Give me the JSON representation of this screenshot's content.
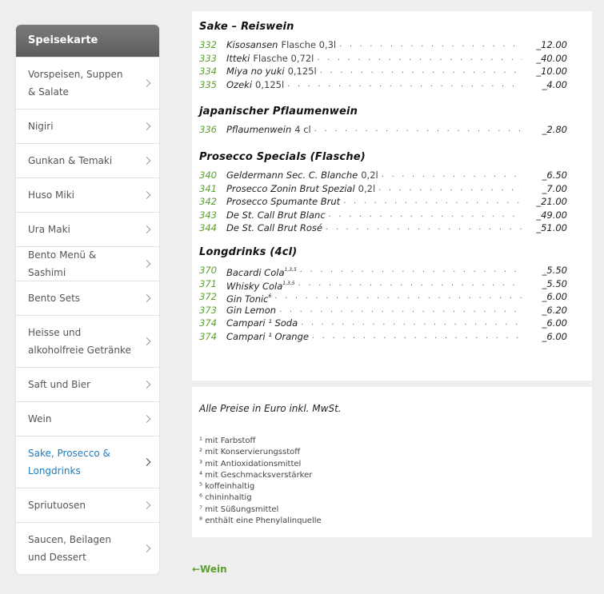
{
  "sidebar": {
    "title": "Speisekarte",
    "items": [
      {
        "label": "Vorspeisen, Suppen & Salate",
        "active": false,
        "lines": 2
      },
      {
        "label": "Nigiri",
        "active": false,
        "lines": 1
      },
      {
        "label": "Gunkan & Temaki",
        "active": false,
        "lines": 1
      },
      {
        "label": "Huso Miki",
        "active": false,
        "lines": 1
      },
      {
        "label": "Ura Maki",
        "active": false,
        "lines": 1
      },
      {
        "label": "Bento Menü & Sashimi",
        "active": false,
        "lines": 1
      },
      {
        "label": "Bento Sets",
        "active": false,
        "lines": 1
      },
      {
        "label": "Heisse und alkoholfreie Getränke",
        "active": false,
        "lines": 2
      },
      {
        "label": "Saft und Bier",
        "active": false,
        "lines": 1
      },
      {
        "label": "Wein",
        "active": false,
        "lines": 1
      },
      {
        "label": "Sake, Prosecco & Longdrinks",
        "active": true,
        "lines": 2
      },
      {
        "label": "Spriutuosen",
        "active": false,
        "lines": 1
      },
      {
        "label": "Saucen, Beilagen und Dessert",
        "active": false,
        "lines": 2
      }
    ]
  },
  "menu": {
    "sections": [
      {
        "title": "Sake – Reiswein",
        "items": [
          {
            "num": "332",
            "name": "Kisosansen",
            "extra": "Flasche 0,3l",
            "sup": "",
            "price": "_12.00"
          },
          {
            "num": "333",
            "name": "Itteki",
            "extra": "Flasche 0,72l",
            "sup": "",
            "price": "_40.00"
          },
          {
            "num": "334",
            "name": "Miya no yuki",
            "extra": "0,125l",
            "sup": "",
            "price": "_10.00"
          },
          {
            "num": "335",
            "name": "Ozeki",
            "extra": "0,125l",
            "sup": "",
            "price": "_4.00"
          }
        ]
      },
      {
        "title": "japanischer Pflaumenwein",
        "items": [
          {
            "num": "336",
            "name": "Pflaumenwein",
            "extra": "4 cl",
            "sup": "",
            "price": "_2.80"
          }
        ]
      },
      {
        "title": "Prosecco Specials (Flasche)",
        "items": [
          {
            "num": "340",
            "name": "Geldermann Sec. C. Blanche",
            "extra": "0,2l",
            "sup": "",
            "price": "_6.50"
          },
          {
            "num": "341",
            "name": "Prosecco Zonin Brut Spezial",
            "extra": "0,2l",
            "sup": "",
            "price": "_7.00"
          },
          {
            "num": "342",
            "name": "Prosecco Spumante Brut",
            "extra": "",
            "sup": "",
            "price": "_21.00"
          },
          {
            "num": "343",
            "name": "De St. Call Brut Blanc",
            "extra": "",
            "sup": "",
            "price": "_49.00"
          },
          {
            "num": "344",
            "name": "De St. Call Brut Rosé",
            "extra": "",
            "sup": "",
            "price": "_51.00"
          }
        ]
      },
      {
        "title": "Longdrinks (4cl)",
        "items": [
          {
            "num": "370",
            "name": "Bacardi Cola",
            "extra": "",
            "sup": "1,3,5",
            "price": "_5.50"
          },
          {
            "num": "371",
            "name": "Whisky Cola",
            "extra": "",
            "sup": "1,3,5",
            "price": "_5.50"
          },
          {
            "num": "372",
            "name": "Gin Tonic",
            "extra": "",
            "sup": "6",
            "price": "_6.00"
          },
          {
            "num": "373",
            "name": "Gin Lemon",
            "extra": "",
            "sup": "",
            "price": "_6.20"
          },
          {
            "num": "374",
            "name": "Campari ¹ Soda",
            "extra": "",
            "sup": "",
            "price": "_6.00"
          },
          {
            "num": "374",
            "name": "Campari ¹ Orange",
            "extra": "",
            "sup": "",
            "price": "_6.00"
          }
        ]
      }
    ]
  },
  "notes": {
    "title": "Alle Preise in Euro inkl. MwSt.",
    "footnotes": [
      "¹ mit Farbstoff",
      "² mit Konservierungsstoff",
      "³ mit Antioxidationsmittel",
      "⁴ mit Geschmacksverstärker",
      "⁵ koffeinhaltig",
      "⁶ chininhaltig",
      "⁷ mit Süßungsmittel",
      "⁸ enthält eine Phenylalinquelle"
    ]
  },
  "back_link": {
    "label": "←Wein"
  },
  "colors": {
    "accent_green": "#5aa02c",
    "active_blue": "#1f7cbf",
    "sidebar_header": "#666666"
  }
}
